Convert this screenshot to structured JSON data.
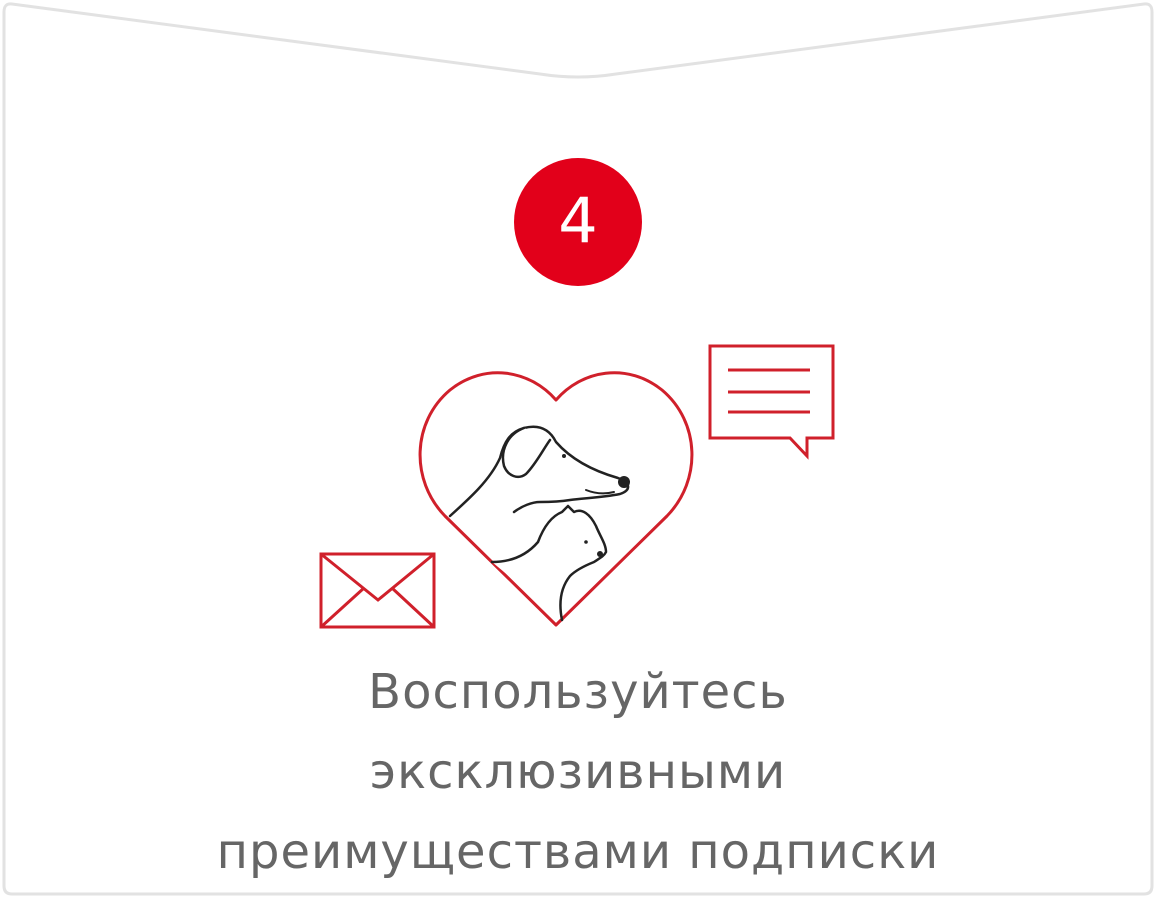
{
  "step": {
    "number": "4",
    "color": "#e2001a"
  },
  "caption": {
    "lines": [
      "Воспользуйтесь",
      "эксклюзивными",
      "преимуществами подписки"
    ],
    "color": "#666666"
  },
  "illustration": {
    "icons": [
      "heart-icon",
      "dog-icon",
      "cat-icon",
      "chat-bubble-icon",
      "envelope-icon"
    ],
    "accent": "#d0202b"
  }
}
